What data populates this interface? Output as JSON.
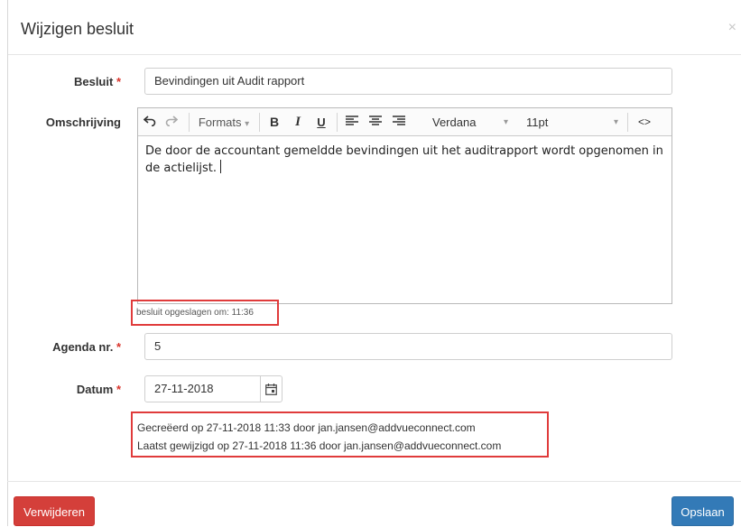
{
  "dialog": {
    "title": "Wijzigen besluit",
    "close_glyph": "×"
  },
  "form": {
    "besluit": {
      "label": "Besluit",
      "required_mark": "*",
      "value": "Bevindingen uit Audit rapport"
    },
    "omschrijving": {
      "label": "Omschrijving",
      "toolbar": {
        "undo_icon": "undo-icon",
        "redo_icon": "redo-icon",
        "formats_label": "Formats",
        "bold_label": "B",
        "italic_label": "I",
        "underline_label": "U",
        "font_family": "Verdana",
        "font_size": "11pt",
        "code_label": "<>"
      },
      "content": "De door de accountant gemeldde bevindingen uit het auditrapport wordt opgenomen in de actielijst."
    },
    "save_status": "besluit opgeslagen om: 11:36",
    "agenda": {
      "label": "Agenda nr.",
      "required_mark": "*",
      "value": "5"
    },
    "datum": {
      "label": "Datum",
      "required_mark": "*",
      "value": "27-11-2018",
      "calendar_icon": "calendar-icon"
    }
  },
  "audit": {
    "created": "Gecreëerd op 27-11-2018 11:33 door jan.jansen@addvueconnect.com",
    "modified": "Laatst gewijzigd op 27-11-2018 11:36 door jan.jansen@addvueconnect.com"
  },
  "footer": {
    "delete_label": "Verwijderen",
    "save_label": "Opslaan"
  },
  "colors": {
    "danger": "#d43f3a",
    "primary": "#337ab7",
    "highlight_box": "#e03b3b",
    "required": "#d9342b"
  }
}
